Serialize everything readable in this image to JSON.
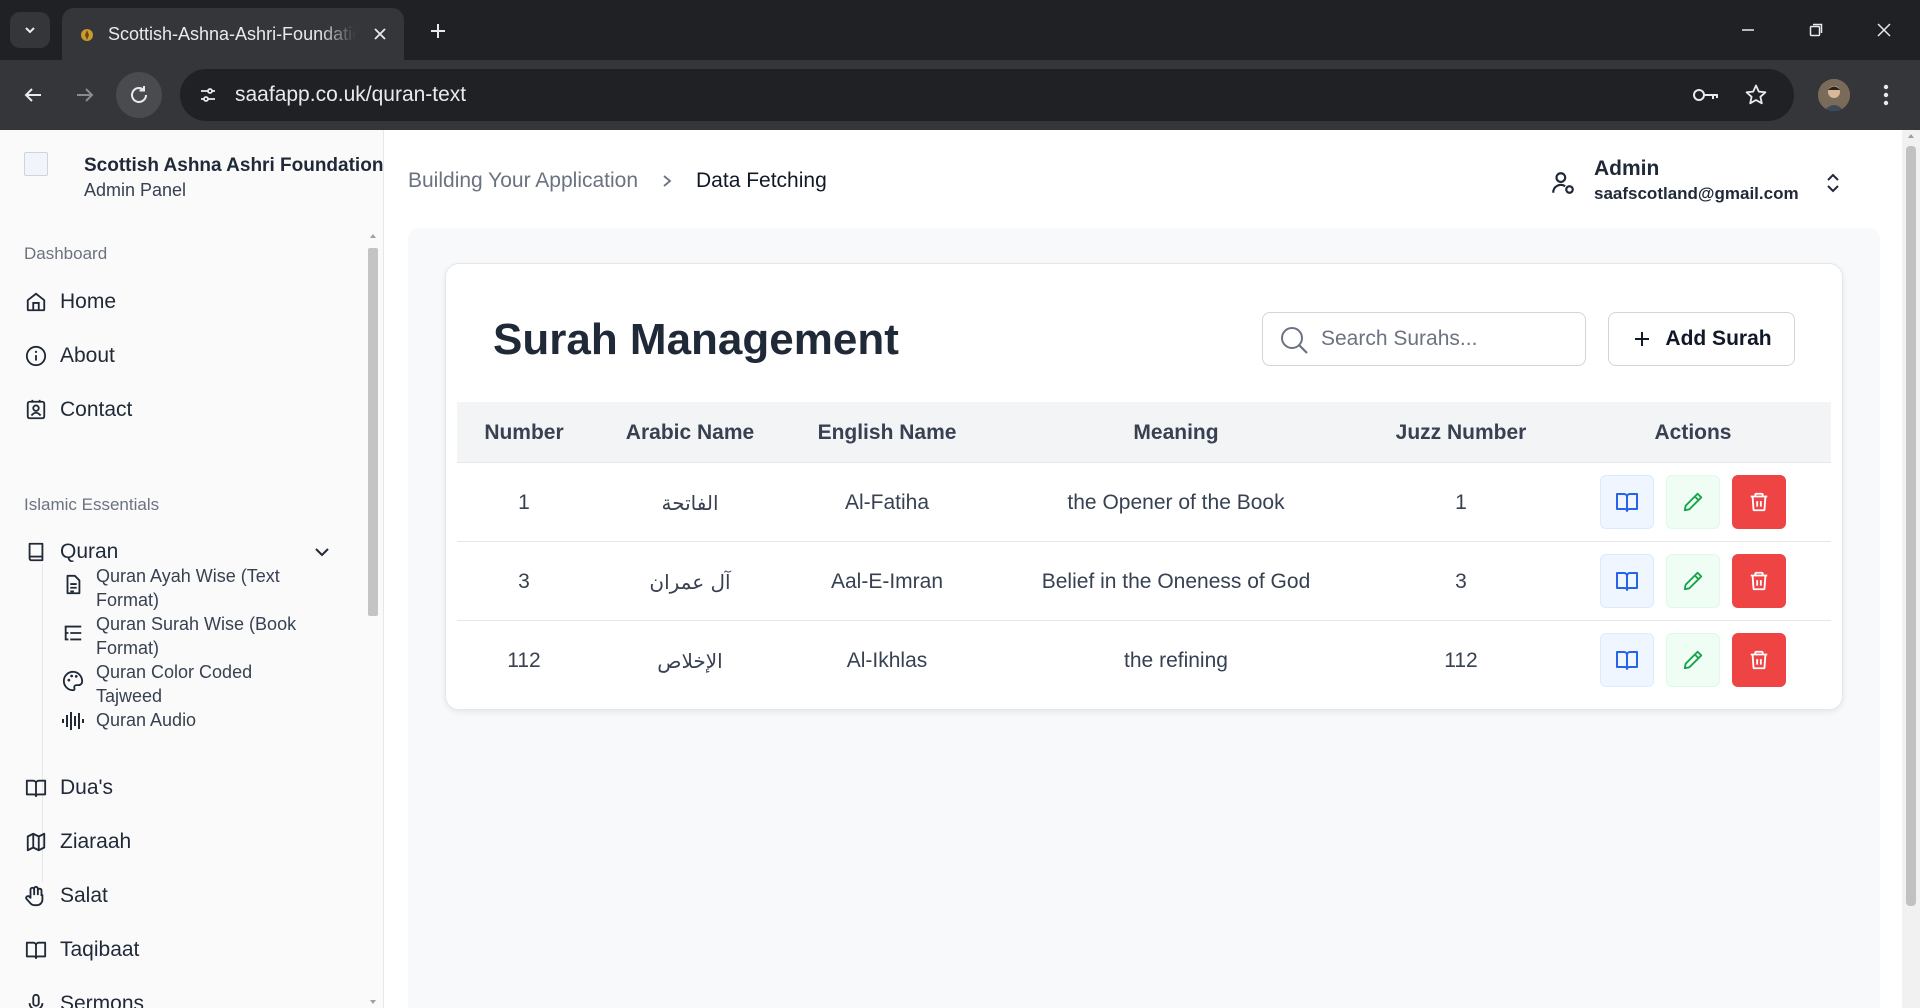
{
  "browser": {
    "tab_title": "Scottish-Ashna-Ashri-Foundation",
    "url": "saafapp.co.uk/quran-text"
  },
  "sidebar": {
    "brand_name": "Scottish Ashna Ashri Foundation",
    "brand_sub": "Admin Panel",
    "groups": [
      {
        "label": "Dashboard",
        "items": [
          {
            "label": "Home",
            "icon": "home-icon"
          },
          {
            "label": "About",
            "icon": "info-icon"
          },
          {
            "label": "Contact",
            "icon": "contact-icon"
          }
        ]
      },
      {
        "label": "Islamic Essentials",
        "items": [
          {
            "label": "Quran",
            "icon": "book-icon",
            "expanded": true
          },
          {
            "label": "Dua's",
            "icon": "open-book-icon"
          },
          {
            "label": "Ziaraah",
            "icon": "map-icon"
          },
          {
            "label": "Salat",
            "icon": "hand-icon"
          },
          {
            "label": "Taqibaat",
            "icon": "open-book-icon"
          },
          {
            "label": "Sermons",
            "icon": "mic-icon"
          }
        ]
      }
    ],
    "quran_sub": [
      {
        "label": "Quran Ayah Wise (Text Format)",
        "icon": "document-icon"
      },
      {
        "label": "Quran Surah Wise (Book Format)",
        "icon": "list-tree-icon"
      },
      {
        "label": "Quran Color Coded Tajweed",
        "icon": "palette-icon"
      },
      {
        "label": "Quran Audio",
        "icon": "audio-wave-icon"
      }
    ]
  },
  "header": {
    "breadcrumb": [
      "Building Your Application",
      "Data Fetching"
    ],
    "user_name": "Admin",
    "user_email": "saafscotland@gmail.com"
  },
  "card": {
    "title": "Surah Management",
    "search_placeholder": "Search Surahs...",
    "add_label": "Add Surah"
  },
  "table": {
    "headers": [
      "Number",
      "Arabic Name",
      "English Name",
      "Meaning",
      "Juzz Number",
      "Actions"
    ],
    "rows": [
      {
        "number": "1",
        "arabic": "الفاتحة",
        "english": "Al-Fatiha",
        "meaning": "the Opener of the Book",
        "juzz": "1"
      },
      {
        "number": "3",
        "arabic": "آل عمران",
        "english": "Aal-E-Imran",
        "meaning": "Belief in the Oneness of God",
        "juzz": "3"
      },
      {
        "number": "112",
        "arabic": "الإخلاص",
        "english": "Al-Ikhlas",
        "meaning": "the refining",
        "juzz": "112"
      }
    ]
  },
  "colors": {
    "delete": "#ef4444",
    "view_icon": "#2563eb",
    "edit_icon": "#16a34a"
  }
}
